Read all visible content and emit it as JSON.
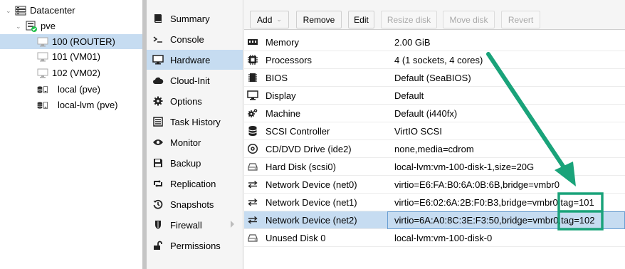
{
  "tree": {
    "items": [
      {
        "label": "Datacenter",
        "icon": "server-icon"
      },
      {
        "label": "pve",
        "icon": "node-online-icon"
      },
      {
        "label": "100 (ROUTER)",
        "icon": "vm-icon"
      },
      {
        "label": "101 (VM01)",
        "icon": "vm-icon"
      },
      {
        "label": "102 (VM02)",
        "icon": "vm-icon"
      },
      {
        "label": "local (pve)",
        "icon": "storage-icon"
      },
      {
        "label": "local-lvm (pve)",
        "icon": "storage-icon"
      }
    ]
  },
  "nav": {
    "items": [
      {
        "label": "Summary",
        "icon": "book-icon"
      },
      {
        "label": "Console",
        "icon": "terminal-icon"
      },
      {
        "label": "Hardware",
        "icon": "desktop-icon"
      },
      {
        "label": "Cloud-Init",
        "icon": "cloud-icon"
      },
      {
        "label": "Options",
        "icon": "gear-icon"
      },
      {
        "label": "Task History",
        "icon": "list-icon"
      },
      {
        "label": "Monitor",
        "icon": "eye-icon"
      },
      {
        "label": "Backup",
        "icon": "floppy-icon"
      },
      {
        "label": "Replication",
        "icon": "retweet-icon"
      },
      {
        "label": "Snapshots",
        "icon": "history-icon"
      },
      {
        "label": "Firewall",
        "icon": "shield-icon"
      },
      {
        "label": "Permissions",
        "icon": "unlock-icon"
      }
    ]
  },
  "toolbar": {
    "add_label": "Add",
    "remove_label": "Remove",
    "edit_label": "Edit",
    "resize_label": "Resize disk",
    "move_label": "Move disk",
    "revert_label": "Revert"
  },
  "hardware": {
    "rows": [
      {
        "key": "Memory",
        "value": "2.00 GiB",
        "icon": "memory-icon"
      },
      {
        "key": "Processors",
        "value": "4 (1 sockets, 4 cores)",
        "icon": "cpu-icon"
      },
      {
        "key": "BIOS",
        "value": "Default (SeaBIOS)",
        "icon": "microchip-icon"
      },
      {
        "key": "Display",
        "value": "Default",
        "icon": "desktop-icon"
      },
      {
        "key": "Machine",
        "value": "Default (i440fx)",
        "icon": "cogs-icon"
      },
      {
        "key": "SCSI Controller",
        "value": "VirtIO SCSI",
        "icon": "database-icon"
      },
      {
        "key": "CD/DVD Drive (ide2)",
        "value": "none,media=cdrom",
        "icon": "cdrom-icon"
      },
      {
        "key": "Hard Disk (scsi0)",
        "value": "local-lvm:vm-100-disk-1,size=20G",
        "icon": "hdd-icon"
      },
      {
        "key": "Network Device (net0)",
        "value": "virtio=E6:FA:B0:6A:0B:6B,bridge=vmbr0",
        "icon": "exchange-icon"
      },
      {
        "key": "Network Device (net1)",
        "value": "virtio=E6:02:6A:2B:F0:B3,bridge=vmbr0,tag=101",
        "icon": "exchange-icon"
      },
      {
        "key": "Network Device (net2)",
        "value": "virtio=6A:A0:8C:3E:F3:50,bridge=vmbr0,tag=102",
        "icon": "exchange-icon"
      },
      {
        "key": "Unused Disk 0",
        "value": "local-lvm:vm-100-disk-0",
        "icon": "hdd-icon"
      }
    ]
  },
  "colors": {
    "selection": "#c6dcf1",
    "annotation": "#1aa37a",
    "node_online": "#21bf4b"
  }
}
